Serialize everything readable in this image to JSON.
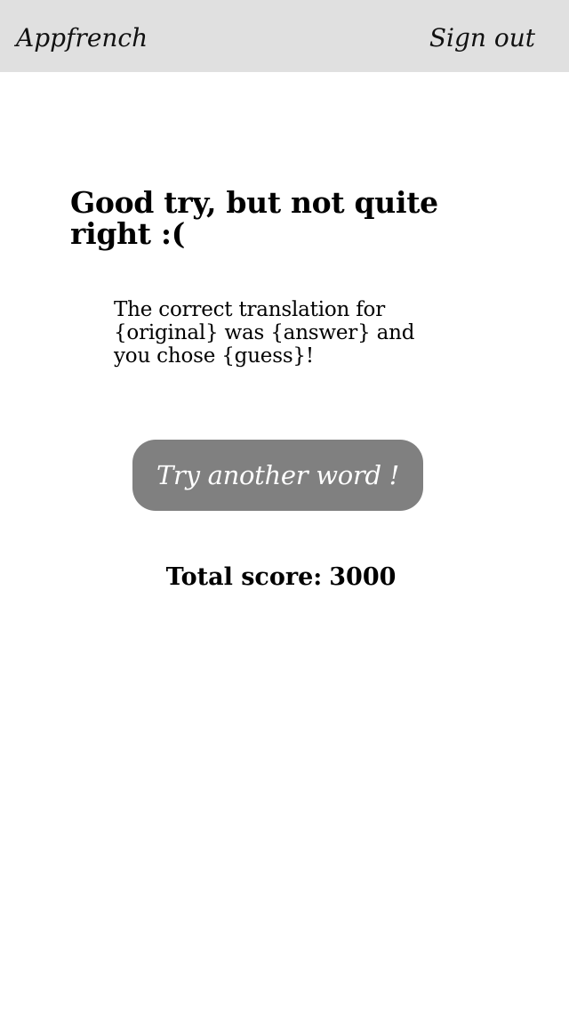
{
  "header": {
    "app_name": "Appfrench",
    "sign_out_label": "Sign out",
    "background_color": "#e0e0e0"
  },
  "result": {
    "heading": "Good try, but not quite right :(",
    "message": "The correct translation for {original} was {answer} and you chose {guess}!"
  },
  "actions": {
    "try_another_label": "Try another word !",
    "button_color": "#808080"
  },
  "score": {
    "label": "Total score:",
    "value": "3000"
  }
}
